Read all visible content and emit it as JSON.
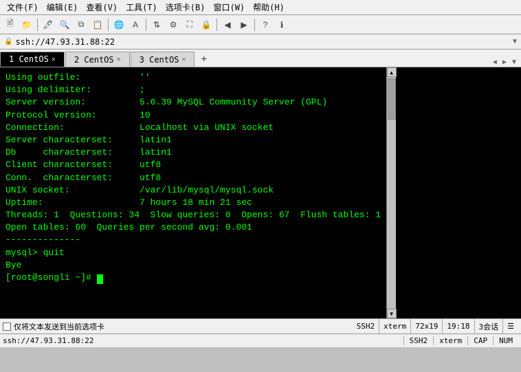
{
  "menubar": {
    "items": [
      "文件(F)",
      "编辑(E)",
      "查看(V)",
      "工具(T)",
      "选项卡(B)",
      "窗口(W)",
      "帮助(H)"
    ]
  },
  "addressbar": {
    "lock_icon": "🔒",
    "url": "ssh://47.93.31.88:22",
    "arrow": "▼"
  },
  "tabs": [
    {
      "label": "1 CentOS",
      "active": true
    },
    {
      "label": "2 CentOS",
      "active": false
    },
    {
      "label": "3 CentOS",
      "active": false
    }
  ],
  "tab_new": "+",
  "terminal": {
    "lines": [
      "Using outfile:           ''",
      "Using delimiter:         ;",
      "Server version:          5.6.39 MySQL Community Server (GPL)",
      "Protocol version:        10",
      "Connection:              Localhost via UNIX socket",
      "Server characterset:     latin1",
      "Db     characterset:     latin1",
      "Client characterset:     utf8",
      "Conn.  characterset:     utf8",
      "UNIX socket:             /var/lib/mysql/mysql.sock",
      "Uptime:                  7 hours 18 min 21 sec",
      "",
      "Threads: 1  Questions: 34  Slow queries: 0  Opens: 67  Flush tables: 1",
      "Open tables: 60  Queries per second avg: 0.001",
      "--------------",
      "",
      "mysql> quit",
      "Bye",
      "[root@songli ~]# "
    ]
  },
  "statusbar": {
    "checkbox_label": "仅将文本发送到当前选项卡",
    "items": [
      "SSH2",
      "xterm",
      "72x19",
      "19:18",
      "3会话"
    ]
  },
  "bottombar": {
    "addr": "ssh://47.93.31.88:22",
    "items": [
      "SSH2",
      "xterm",
      "CAP",
      "NUM"
    ]
  }
}
